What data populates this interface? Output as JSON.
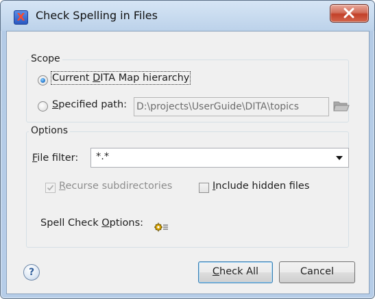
{
  "window": {
    "title": "Check Spelling in Files",
    "app_icon": "x-letter-app-icon",
    "close_icon": "close-icon"
  },
  "scope": {
    "legend": "Scope",
    "current_map": {
      "label_pre": "Current ",
      "label_accel": "D",
      "label_post": "ITA Map hierarchy",
      "checked": true
    },
    "specified_path": {
      "label_accel": "S",
      "label_post": "pecified path:",
      "checked": false,
      "value": "D:\\projects\\UserGuide\\DITA\\topics"
    },
    "browse_icon": "folder-icon"
  },
  "options": {
    "legend": "Options",
    "file_filter": {
      "label_accel": "F",
      "label_post": "ile filter:",
      "value": "*.*"
    },
    "recurse": {
      "label_accel": "R",
      "label_post": "ecurse subdirectories",
      "checked": true,
      "disabled": true
    },
    "hidden": {
      "label_accel": "I",
      "label_post": "nclude hidden files",
      "checked": false
    },
    "spell_check": {
      "label_pre": "Spell Check ",
      "label_accel": "O",
      "label_post": "ptions:",
      "icon": "gear-options-icon"
    }
  },
  "footer": {
    "help_label": "?",
    "check_all": {
      "accel": "C",
      "rest": "heck All"
    },
    "cancel_label": "Cancel"
  },
  "colors": {
    "title_bg": "#bcd2ea",
    "client_bg": "#f0f0f0",
    "close_red": "#c2412a",
    "default_border": "#3c7fb1"
  }
}
